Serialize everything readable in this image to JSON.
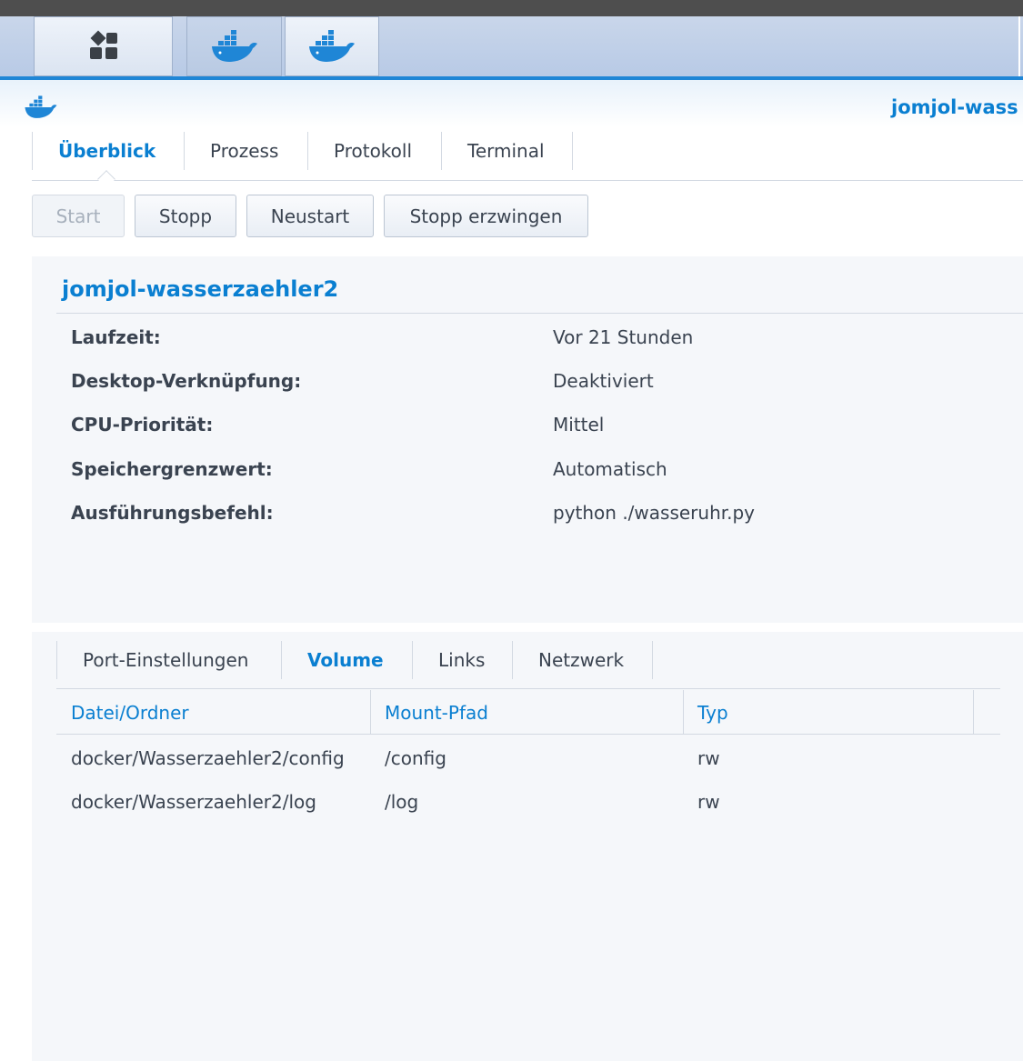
{
  "taskbar": {
    "launcher_icon": "grid-launcher-icon",
    "apps": [
      {
        "icon": "docker-whale-icon"
      },
      {
        "icon": "docker-whale-icon"
      }
    ]
  },
  "window": {
    "app_icon": "docker-whale-icon",
    "title": "jomjol-wass"
  },
  "tabs": [
    {
      "label": "Überblick",
      "active": true
    },
    {
      "label": "Prozess"
    },
    {
      "label": "Protokoll"
    },
    {
      "label": "Terminal"
    }
  ],
  "actions": {
    "start": "Start",
    "stop": "Stopp",
    "restart": "Neustart",
    "force_stop": "Stopp erzwingen"
  },
  "overview": {
    "name": "jomjol-wasserzaehler2",
    "rows": [
      {
        "label": "Laufzeit:",
        "value": "Vor 21 Stunden"
      },
      {
        "label": "Desktop-Verknüpfung:",
        "value": "Deaktiviert"
      },
      {
        "label": "CPU-Priorität:",
        "value": "Mittel"
      },
      {
        "label": "Speichergrenzwert:",
        "value": "Automatisch"
      },
      {
        "label": "Ausführungsbefehl:",
        "value": "python ./wasseruhr.py"
      }
    ]
  },
  "subtabs": [
    {
      "label": "Port-Einstellungen"
    },
    {
      "label": "Volume",
      "active": true
    },
    {
      "label": "Links"
    },
    {
      "label": "Netzwerk"
    }
  ],
  "volumes": {
    "columns": [
      "Datei/Ordner",
      "Mount-Pfad",
      "Typ"
    ],
    "rows": [
      [
        "docker/Wasserzaehler2/config",
        "/config",
        "rw"
      ],
      [
        "docker/Wasserzaehler2/log",
        "/log",
        "rw"
      ]
    ]
  },
  "colors": {
    "accent": "#0a7fd1",
    "text": "#3a4350",
    "panel": "#f5f7fa",
    "whale": "#1f86d6"
  }
}
